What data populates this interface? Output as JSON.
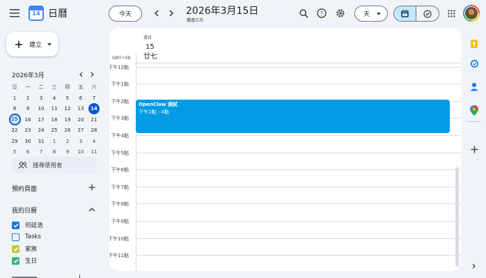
{
  "header": {
    "app_title": "日曆",
    "logo_day": "14",
    "today_button": "今天",
    "date_title": "2026年3月15日",
    "lunar_subtitle": "農曆正月",
    "view_select": "天",
    "icons": [
      "menu-icon",
      "chevron-left-icon",
      "chevron-right-icon",
      "search-icon",
      "help-icon",
      "settings-icon",
      "calendar-view-icon",
      "tasks-view-icon",
      "apps-grid-icon",
      "account-avatar"
    ]
  },
  "sidebar": {
    "create_button": "建立",
    "mini_calendar": {
      "month_title": "2026年3月",
      "weekday_headers": [
        "日",
        "一",
        "二",
        "三",
        "四",
        "五",
        "六"
      ],
      "weeks": [
        [
          "1",
          "2",
          "3",
          "4",
          "5",
          "6",
          "7"
        ],
        [
          "8",
          "9",
          "10",
          "11",
          "12",
          "13",
          "14"
        ],
        [
          "15",
          "16",
          "17",
          "18",
          "19",
          "20",
          "21"
        ],
        [
          "22",
          "23",
          "24",
          "25",
          "26",
          "27",
          "28"
        ],
        [
          "29",
          "30",
          "31",
          "1",
          "2",
          "3",
          "4"
        ],
        [
          "5",
          "6",
          "7",
          "8",
          "9",
          "10",
          "11"
        ]
      ],
      "today": "14",
      "selected": "15"
    },
    "search_people_placeholder": "搜尋使用者",
    "booking_pages_label": "預約頁面",
    "my_calendars_label": "我的日曆",
    "calendars": [
      {
        "name": "何廷浩",
        "checked": true,
        "color": "#1a73e8"
      },
      {
        "name": "Tasks",
        "checked": false,
        "color": "#1a73e8"
      },
      {
        "name": "家族",
        "checked": true,
        "color": "#c0ca33"
      },
      {
        "name": "生日",
        "checked": true,
        "color": "#33b679"
      }
    ]
  },
  "main": {
    "day_of_week": "週日",
    "day_number": "15",
    "lunar_day": "廿七",
    "timezone": "GMT+08",
    "hours": [
      "下午12點",
      "下午1點",
      "下午2點",
      "下午3點",
      "下午4點",
      "下午5點",
      "下午6點",
      "下午7點",
      "下午8點",
      "下午9點",
      "下午10點",
      "下午11點"
    ],
    "event": {
      "title": "OpenClaw 測試",
      "time": "下午2點 - 4點",
      "color": "#039be5"
    }
  },
  "colors": {
    "accent": "#0b57d0",
    "today_circle": "#0b57d0",
    "selected_view": "#c2e7ff"
  }
}
